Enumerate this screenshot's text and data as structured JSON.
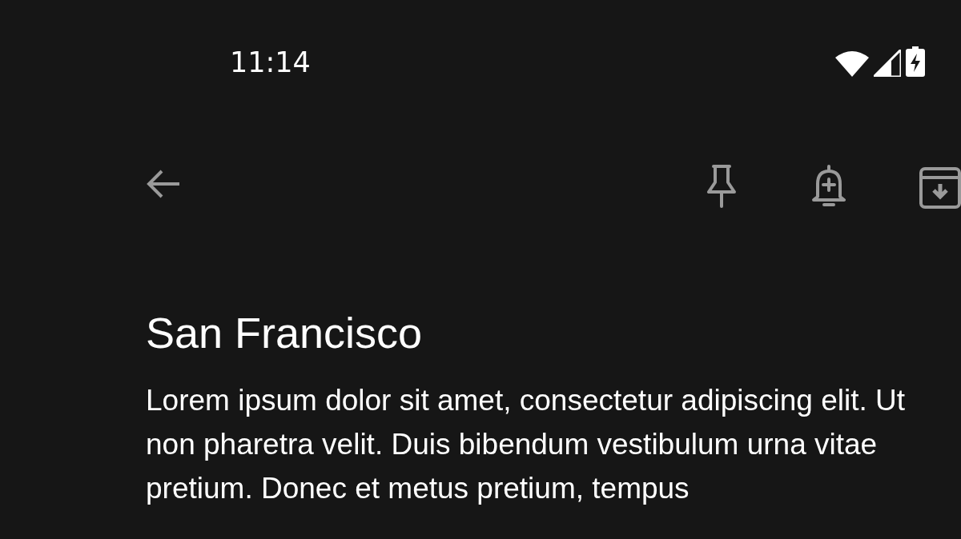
{
  "status_bar": {
    "time": "11:14"
  },
  "note": {
    "title": "San Francisco",
    "body": "Lorem ipsum dolor sit amet, consectetur adipiscing elit. Ut non pharetra velit. Duis bibendum vestibulum urna vitae pretium. Donec et metus pretium, tempus"
  }
}
